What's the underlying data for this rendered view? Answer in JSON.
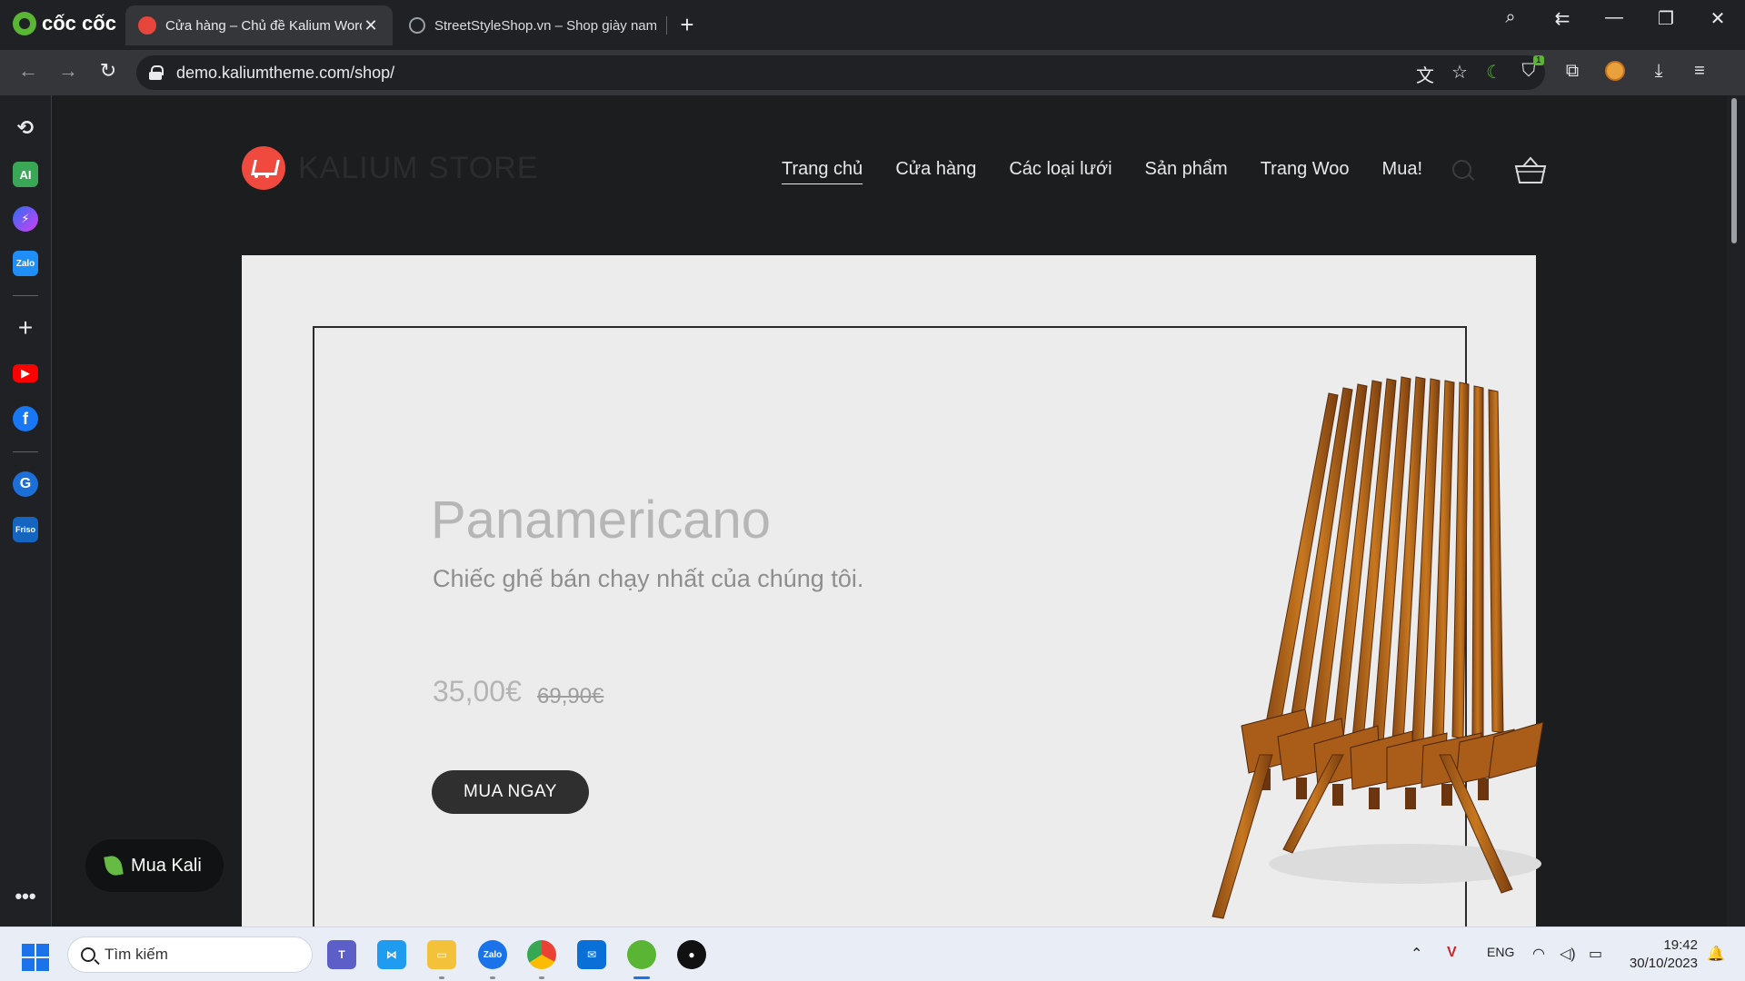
{
  "browser": {
    "brand": "cốc cốc",
    "tabs": [
      {
        "title": "Cửa hàng – Chủ đề Kalium Word",
        "active": true
      },
      {
        "title": "StreetStyleShop.vn – Shop giày nam",
        "active": false
      }
    ],
    "url": "demo.kaliumtheme.com/shop/",
    "extension_badge": "1"
  },
  "sidebar": {
    "items": [
      "history-icon",
      "ai-icon",
      "messenger-icon",
      "zalo-icon",
      "add-icon",
      "youtube-icon",
      "facebook-icon",
      "grammarly-icon",
      "friso-icon",
      "more-icon"
    ],
    "ai_label": "AI",
    "zalo_label": "Zalo",
    "friso_label": "Friso"
  },
  "site": {
    "name": "KALIUM STORE",
    "nav": [
      "Trang chủ",
      "Cửa hàng",
      "Các loại lưới",
      "Sản phẩm",
      "Trang Woo",
      "Mua!"
    ],
    "current_nav": "Trang chủ"
  },
  "hero": {
    "title": "Panamericano",
    "subtitle": "Chiếc ghế bán chạy nhất của chúng tôi.",
    "price": "35,00€",
    "old_price": "69,90€",
    "button": "MUA NGAY"
  },
  "chat": {
    "label": "Mua Kali"
  },
  "taskbar": {
    "search_placeholder": "Tìm kiếm",
    "language": "ENG",
    "time": "19:42",
    "date": "30/10/2023",
    "zalo_label": "Zalo"
  },
  "colors": {
    "accent": "#f04a3e",
    "page_bg": "#1b1d1f",
    "hero_bg": "#ececec",
    "button_bg": "#2f2f2f"
  }
}
